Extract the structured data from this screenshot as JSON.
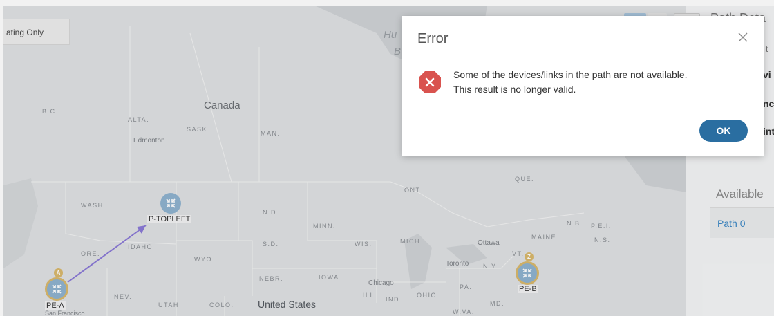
{
  "toolbar": {
    "mode_label": "ating Only"
  },
  "map": {
    "regions": [
      "B.C.",
      "ALTA.",
      "SASK.",
      "MAN.",
      "ONT.",
      "QUE.",
      "WASH.",
      "N.D.",
      "MINN.",
      "ORE.",
      "IDAHO",
      "WYO.",
      "S.D.",
      "WIS.",
      "MICH.",
      "N.Y.",
      "VT.",
      "MAINE",
      "N.B.",
      "P.E.I.",
      "N.S.",
      "NEBR.",
      "IOWA",
      "ILL.",
      "IND.",
      "OHIO",
      "PA.",
      "MD.",
      "W.VA.",
      "NEV.",
      "UTAH",
      "COLO."
    ],
    "countries": {
      "canada": "Canada",
      "usa": "United States"
    },
    "cities": [
      "Edmonton",
      "Ottawa",
      "Toronto",
      "Chicago",
      "San Francisco"
    ],
    "water": [
      "Hu",
      "B"
    ]
  },
  "nodes": [
    {
      "name": "P-TOPLEFT"
    },
    {
      "name": "PE-A",
      "badge": "A"
    },
    {
      "name": "PE-B",
      "badge": "Z"
    }
  ],
  "colors": {
    "link": "#8b7ad6",
    "node": "#8fb3cf",
    "endpoint_ring": "#d9b86c",
    "ok_button": "#2a6ea1",
    "error_icon": "#d9534f",
    "path_link": "#3c87c5"
  },
  "side_panel": {
    "title": "Path Deta",
    "subtitle": "n t",
    "bold1": "vi",
    "bold2": "nc",
    "bold3": "int",
    "available_label": "Available",
    "paths": [
      "Path 0"
    ]
  },
  "dialog": {
    "title": "Error",
    "close_icon": "close-icon",
    "error_icon": "error-octagon-icon",
    "message_line1": "Some of the devices/links in the path are not available.",
    "message_line2": "This result is no longer valid.",
    "ok_label": "OK"
  }
}
